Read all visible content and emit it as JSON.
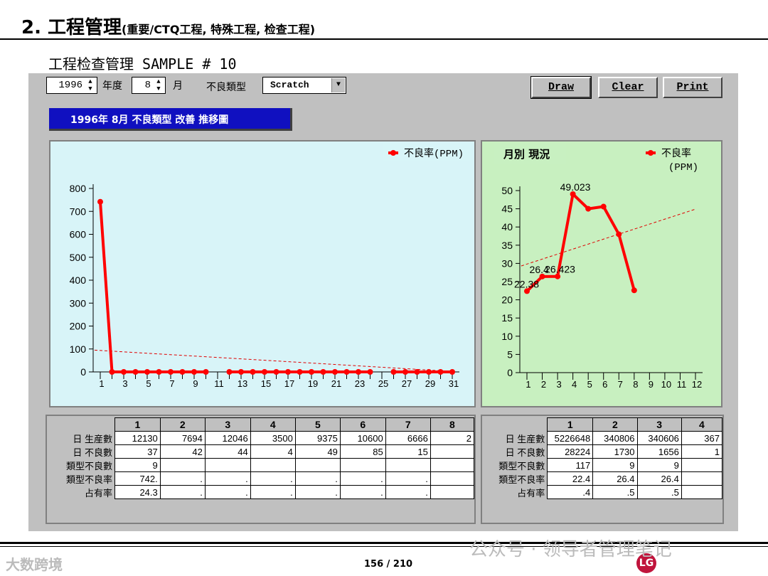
{
  "header": {
    "title": "2.  工程管理",
    "subtitle": "(重要/CTQ工程, 特殊工程, 检查工程)"
  },
  "app": {
    "title": "工程检查管理   SAMPLE # 10"
  },
  "toolbar": {
    "year_value": "1996",
    "year_label": "年度",
    "month_value": "8",
    "month_label": "月",
    "defect_type_label": "不良類型",
    "defect_type_value": "Scratch",
    "draw_label": "Draw",
    "clear_label": "Clear",
    "print_label": "Print"
  },
  "caption": "1996年 8月 不良類型 改善 推移圖",
  "chart_data": [
    {
      "type": "line",
      "legend": "不良率(PPM)",
      "legend_position": "top-right",
      "x": [
        1,
        2,
        3,
        4,
        5,
        6,
        7,
        8,
        9,
        10,
        11,
        12,
        13,
        14,
        15,
        16,
        17,
        18,
        19,
        20,
        21,
        22,
        23,
        24,
        25,
        26,
        27,
        28,
        29,
        30,
        31
      ],
      "values": [
        742,
        0,
        0,
        0,
        0,
        0,
        0,
        0,
        0,
        0,
        null,
        0,
        0,
        0,
        0,
        0,
        0,
        0,
        0,
        0,
        0,
        0,
        0,
        0,
        null,
        0,
        0,
        0,
        0,
        0,
        0
      ],
      "trend": [
        95,
        2
      ],
      "ylim": [
        0,
        800
      ],
      "yticks": [
        0,
        100,
        200,
        300,
        400,
        500,
        600,
        700,
        800
      ],
      "xticks": [
        1,
        3,
        5,
        7,
        9,
        11,
        13,
        15,
        17,
        19,
        21,
        23,
        25,
        27,
        29,
        31
      ],
      "background": "#d8f4f8",
      "line_color": "#ff0000",
      "grid": false
    },
    {
      "type": "line",
      "title": "月別 現況",
      "legend": "不良率\n(PPM)",
      "legend_position": "top-right",
      "x": [
        1,
        2,
        3,
        4,
        5,
        6,
        7,
        8,
        9,
        10,
        11,
        12
      ],
      "values": [
        22.38,
        26.4,
        26.423,
        49.023,
        45,
        45.6,
        38,
        22.6,
        null,
        null,
        null,
        null
      ],
      "data_labels": {
        "1": "22.38",
        "2": "26.4",
        "3": "26.423",
        "4": "49.023"
      },
      "trend": [
        29.3,
        44.9
      ],
      "ylim": [
        0,
        50
      ],
      "yticks": [
        0,
        5,
        10,
        15,
        20,
        25,
        30,
        35,
        40,
        45,
        50
      ],
      "xticks": [
        1,
        2,
        3,
        4,
        5,
        6,
        7,
        8,
        9,
        10,
        11,
        12
      ],
      "background": "#c8f0c0",
      "line_color": "#ff0000",
      "grid": false
    }
  ],
  "daily_table": {
    "columns": [
      "1",
      "2",
      "3",
      "4",
      "5",
      "6",
      "7",
      "8"
    ],
    "rows": [
      {
        "label": "日 生産數",
        "cells": [
          "12130",
          "7694",
          "12046",
          "3500",
          "9375",
          "10600",
          "6666",
          "2"
        ]
      },
      {
        "label": "日 不良數",
        "cells": [
          "37",
          "42",
          "44",
          "4",
          "49",
          "85",
          "15",
          ""
        ]
      },
      {
        "label": "類型不良數",
        "cells": [
          "9",
          "",
          "",
          "",
          "",
          "",
          "",
          ""
        ]
      },
      {
        "label": "類型不良率",
        "cells": [
          "742.",
          ".",
          ".",
          ".",
          ".",
          ".",
          ".",
          ""
        ]
      },
      {
        "label": "占有率",
        "cells": [
          "24.3",
          ".",
          ".",
          ".",
          ".",
          ".",
          ".",
          ""
        ]
      }
    ]
  },
  "monthly_table": {
    "columns": [
      "1",
      "2",
      "3",
      "4"
    ],
    "rows": [
      {
        "label": "日 生産數",
        "cells": [
          "5226648",
          "340806",
          "340606",
          "367"
        ]
      },
      {
        "label": "日 不良數",
        "cells": [
          "28224",
          "1730",
          "1656",
          "1"
        ]
      },
      {
        "label": "類型不良數",
        "cells": [
          "117",
          "9",
          "9",
          ""
        ]
      },
      {
        "label": "類型不良率",
        "cells": [
          "22.4",
          "26.4",
          "26.4",
          ""
        ]
      },
      {
        "label": "占有率",
        "cells": [
          ".4",
          ".5",
          ".5",
          ""
        ]
      }
    ]
  },
  "footer": {
    "page": "156 / 210",
    "logo_text": "LG"
  },
  "watermarks": {
    "left": "大数跨境",
    "right": "公众号 · 领导者管理笔记"
  }
}
